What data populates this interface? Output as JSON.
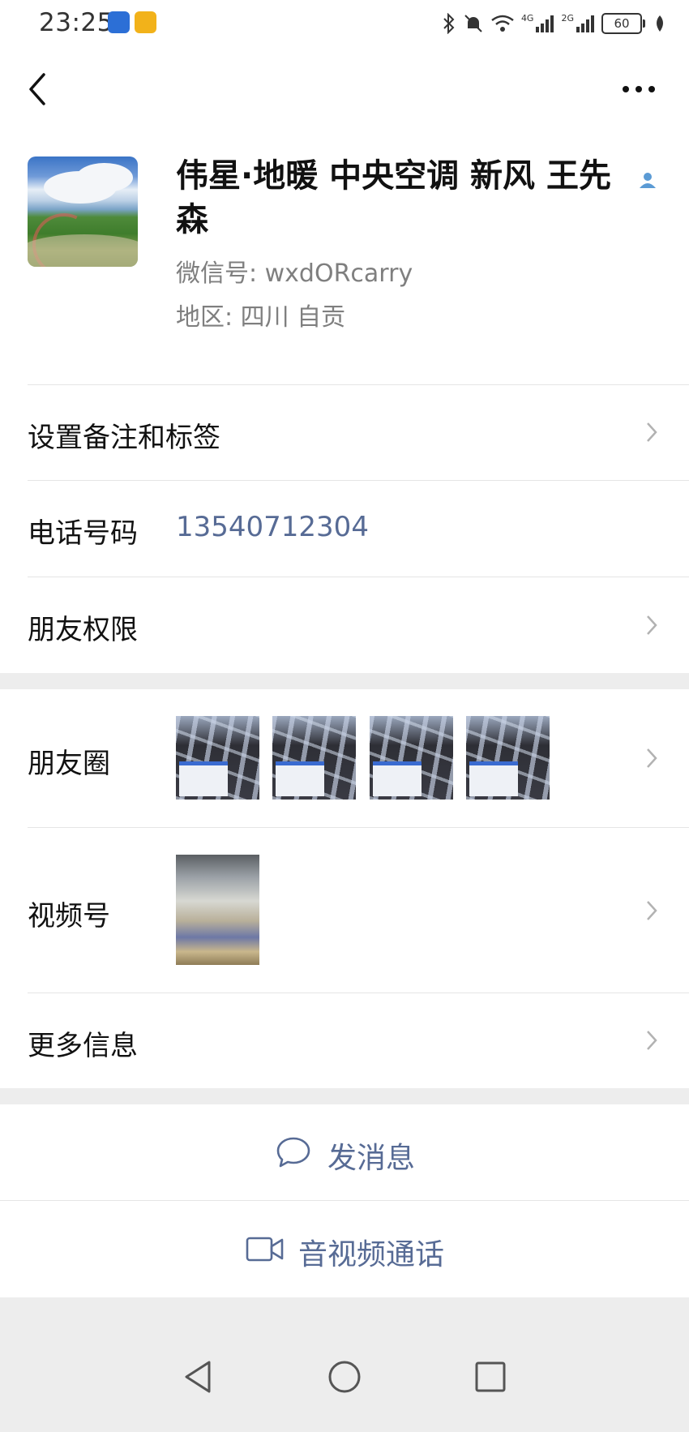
{
  "status_bar": {
    "time": "23:25",
    "battery": "60",
    "net1": "4G",
    "net2": "2G"
  },
  "nav": {
    "back_icon": "back-chevron-icon",
    "more_icon": "more-dots-icon"
  },
  "profile": {
    "name": "伟星·地暖 中央空调 新风 王先森",
    "wechat_id": "微信号:  wxdORcarry",
    "region": "地区:  四川  自贡"
  },
  "rows": {
    "remark_tags": "设置备注和标签",
    "phone_label": "电话号码",
    "phone_value": "13540712304",
    "friend_permissions": "朋友权限",
    "moments": "朋友圈",
    "channels": "视频号",
    "more_info": "更多信息"
  },
  "actions": {
    "message": "发消息",
    "call": "音视频通话"
  },
  "colors": {
    "link": "#576b95",
    "background": "#ededed",
    "badge": "#5b9bd5"
  }
}
